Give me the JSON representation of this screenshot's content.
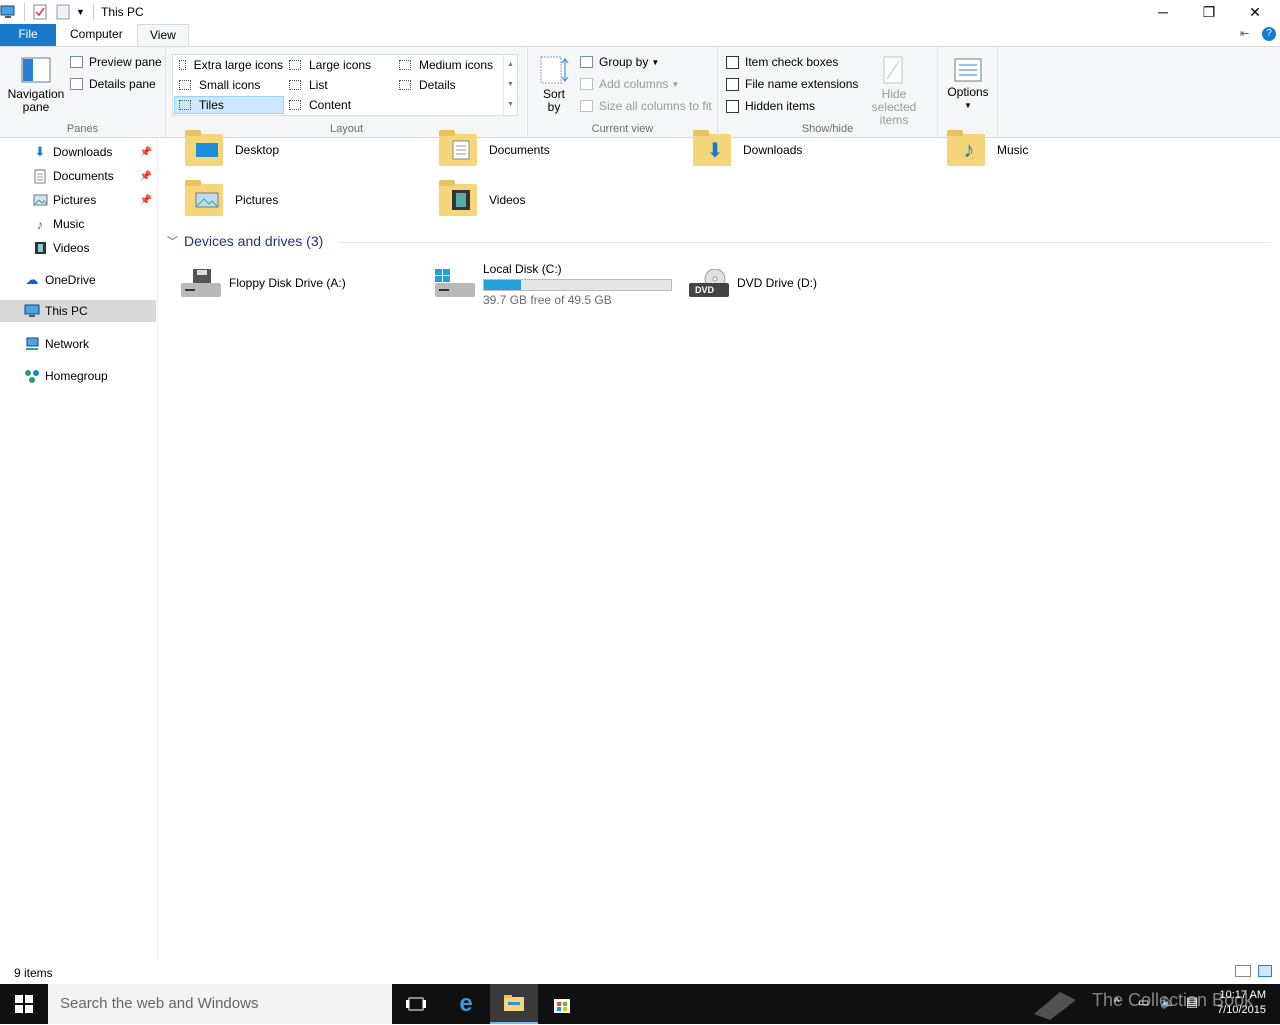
{
  "window": {
    "title": "This PC"
  },
  "caption": {
    "minimize": "─",
    "maximize": "❐",
    "close": "✕"
  },
  "tabs": [
    {
      "label": "File"
    },
    {
      "label": "Computer"
    },
    {
      "label": "View"
    }
  ],
  "ribbon": {
    "panes": {
      "label": "Panes",
      "navigation_pane": "Navigation pane",
      "preview_pane": "Preview pane",
      "details_pane": "Details pane"
    },
    "layout": {
      "label": "Layout",
      "items": [
        {
          "label": "Extra large icons"
        },
        {
          "label": "Large icons"
        },
        {
          "label": "Medium icons"
        },
        {
          "label": "Small icons"
        },
        {
          "label": "List"
        },
        {
          "label": "Details"
        },
        {
          "label": "Tiles",
          "selected": true
        },
        {
          "label": "Content"
        }
      ]
    },
    "current_view": {
      "label": "Current view",
      "sort_by": "Sort by",
      "group_by": "Group by",
      "add_columns": "Add columns",
      "size_columns": "Size all columns to fit"
    },
    "show_hide": {
      "label": "Show/hide",
      "item_check_boxes": "Item check boxes",
      "file_name_extensions": "File name extensions",
      "hidden_items": "Hidden items",
      "hide_selected": "Hide selected items"
    },
    "options": {
      "label": "Options"
    }
  },
  "nav": {
    "items": [
      {
        "label": "Downloads",
        "icon": "download-arrow-icon",
        "pinned": true
      },
      {
        "label": "Documents",
        "icon": "document-icon",
        "pinned": true
      },
      {
        "label": "Pictures",
        "icon": "picture-icon",
        "pinned": true
      },
      {
        "label": "Music",
        "icon": "music-note-icon",
        "pinned": false
      },
      {
        "label": "Videos",
        "icon": "film-icon",
        "pinned": false
      },
      {
        "label": "OneDrive",
        "icon": "cloud-icon"
      },
      {
        "label": "This PC",
        "icon": "computer-icon",
        "selected": true
      },
      {
        "label": "Network",
        "icon": "network-icon"
      },
      {
        "label": "Homegroup",
        "icon": "homegroup-icon"
      }
    ]
  },
  "folders": [
    {
      "label": "Desktop"
    },
    {
      "label": "Documents"
    },
    {
      "label": "Downloads"
    },
    {
      "label": "Music"
    },
    {
      "label": "Pictures"
    },
    {
      "label": "Videos"
    }
  ],
  "devices": {
    "header": "Devices and drives (3)",
    "items": [
      {
        "label": "Floppy Disk Drive (A:)"
      },
      {
        "label": "Local Disk (C:)",
        "free_text": "39.7 GB free of 49.5 GB",
        "used_fraction": 0.198
      },
      {
        "label": "DVD Drive (D:)",
        "badge": "DVD"
      }
    ]
  },
  "status": {
    "count": "9 items"
  },
  "taskbar": {
    "search_placeholder": "Search the web and Windows",
    "time": "10:17 AM",
    "date": "7/10/2015",
    "watermark": "The Collection Book"
  },
  "colors": {
    "accent": "#1979ca",
    "selection": "#cce8ff",
    "drive_fill": "#26a0da",
    "header_blue": "#1e3287"
  }
}
